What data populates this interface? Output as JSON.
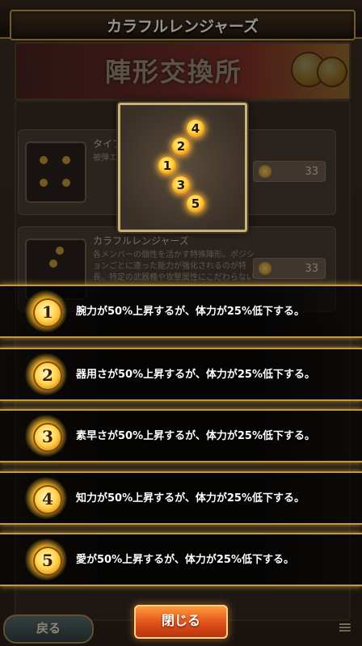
{
  "header": {
    "title": "カラフルレンジャーズ"
  },
  "banner": {
    "text": "陣形交換所"
  },
  "shop_items": [
    {
      "name": "タイプ",
      "desc": "被弾エリア…陣形狙",
      "price": "33"
    },
    {
      "name": "カラフルレンジャーズ",
      "desc": "各メンバーの個性を活かす特殊陣形。ポジションごとに違った能力が強化されるのが特長。特定の武器種や攻撃属性にこだわらない",
      "price": "33"
    }
  ],
  "pattern": {
    "slots": [
      "4",
      "2",
      "1",
      "3",
      "5"
    ]
  },
  "effects": [
    {
      "number": "1",
      "text": "腕力が50%上昇するが、体力が25%低下する。"
    },
    {
      "number": "2",
      "text": "器用さが50%上昇するが、体力が25%低下する。"
    },
    {
      "number": "3",
      "text": "素早さが50%上昇するが、体力が25%低下する。"
    },
    {
      "number": "4",
      "text": "知力が50%上昇するが、体力が25%低下する。"
    },
    {
      "number": "5",
      "text": "愛が50%上昇するが、体力が25%低下する。"
    }
  ],
  "buttons": {
    "close": "閉じる",
    "back": "戻る",
    "menu": "≡"
  },
  "colors": {
    "accent_gold": "#c29a3a",
    "close_button": "#e0501a"
  }
}
